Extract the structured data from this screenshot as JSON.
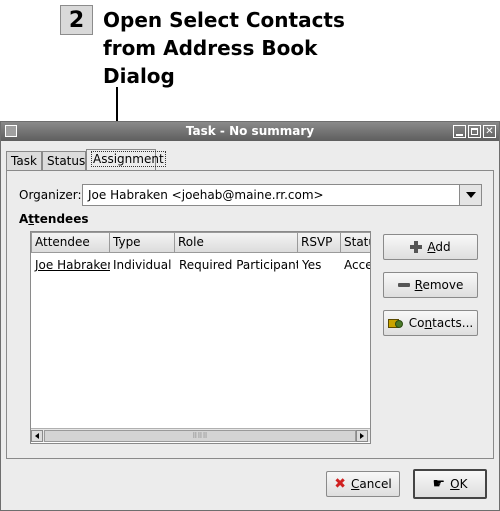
{
  "callout": {
    "number": "2",
    "lines": [
      "Open Select Contacts",
      "from Address Book",
      "Dialog"
    ]
  },
  "window": {
    "title": "Task - No summary",
    "controls": [
      "minimize-icon",
      "maximize-icon",
      "close-icon"
    ]
  },
  "tabs": [
    "Task",
    "Status",
    "Assignment"
  ],
  "active_tab": "Assignment",
  "organizer": {
    "label": "Organizer:",
    "value": "Joe Habraken <joehab@maine.rr.com>"
  },
  "attendees": {
    "heading_prefix": "A",
    "heading_mnemonic": "t",
    "heading_rest": "tendees",
    "columns": [
      "Attendee",
      "Type",
      "Role",
      "RSVP",
      "Statu"
    ],
    "rows": [
      [
        "Joe Habraken",
        "Individual",
        "Required Participant",
        "Yes",
        "Acce"
      ]
    ]
  },
  "buttons": {
    "add": {
      "mnemonic": "A",
      "rest": "dd",
      "icon": "plus-icon"
    },
    "remove": {
      "mnemonic": "R",
      "rest": "emove",
      "icon": "minus-icon"
    },
    "contacts": {
      "prefix": "Co",
      "mnemonic": "n",
      "rest": "tacts...",
      "icon": "address-book-icon"
    },
    "cancel": {
      "mnemonic": "C",
      "rest": "ancel",
      "icon": "cancel-x-icon"
    },
    "ok": {
      "mnemonic": "O",
      "rest": "K",
      "icon": "ok-hand-icon"
    }
  },
  "colors": {
    "titlebar": "#6e6e6e",
    "cancel_icon": "#d02020",
    "add_icon": "#444444"
  }
}
